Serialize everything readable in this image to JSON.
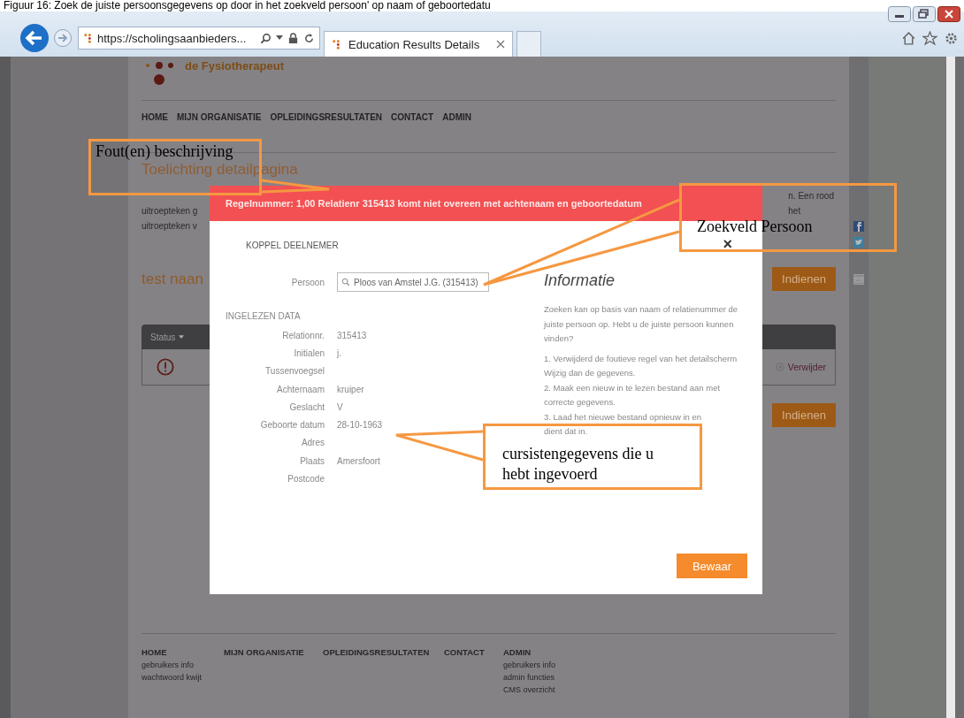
{
  "caption": "Figuur 16: Zoek de juiste persoonsgegevens op door in het zoekveld persoon' op naam of geboortedatu",
  "browser": {
    "url": "https://scholingsaanbieders...",
    "tabs": [
      {
        "title": "Education Results Details",
        "selected": true
      }
    ]
  },
  "site": {
    "logo": "de Fysiotherapeut",
    "nav": [
      "HOME",
      "MIJN ORGANISATIE",
      "OPLEIDINGSRESULTATEN",
      "CONTACT",
      "ADMIN"
    ],
    "heading": "Toelichting detailpagina",
    "intro_left": [
      "uitroepteken g",
      "uitroepteken v"
    ],
    "intro_right": [
      "n. Een rood",
      "het"
    ],
    "section_title": "test naan",
    "submit_buttons": [
      "Indienen",
      "Indienen"
    ],
    "table": {
      "columns": [
        "Status"
      ],
      "rows": [
        {
          "kind": "error",
          "action": "Verwijder"
        }
      ]
    },
    "footer": [
      {
        "title": "HOME",
        "links": [
          "gebruikers info",
          "wachtwoord kwijt"
        ]
      },
      {
        "title": "MIJN ORGANISATIE"
      },
      {
        "title": "OPLEIDINGSRESULTATEN"
      },
      {
        "title": "CONTACT"
      },
      {
        "title": "ADMIN",
        "links": [
          "gebruikers info",
          "admin functies",
          "CMS overzicht"
        ]
      }
    ]
  },
  "modal": {
    "error": "Regelnummer: 1,00 Relatienr 315413 komt niet overeen met achtenaam en geboortedatum",
    "title": "KOPPEL DEELNEMER",
    "close": "×",
    "person_label": "Persoon",
    "person_value": "Ploos van Amstel J.G. (315413)",
    "data_title": "INGELEZEN DATA",
    "fields": [
      {
        "label": "Relationnr.",
        "value": "315413"
      },
      {
        "label": "Initialen",
        "value": "j."
      },
      {
        "label": "Tussenvoegsel"
      },
      {
        "label": "Achternaam",
        "value": "kruiper"
      },
      {
        "label": "Geslacht",
        "value": "V"
      },
      {
        "label": "Geboorte datum",
        "value": "28-10-1963"
      },
      {
        "label": "Adres"
      },
      {
        "label": "Plaats",
        "value": "Amersfoort"
      },
      {
        "label": "Postcode"
      }
    ],
    "info_title": "Informatie",
    "info_intro": "Zoeken kan op basis van naam of relatienummer de juiste persoon op. Hebt u de juiste persoon kunnen vinden?",
    "info_steps": [
      "1. Verwijderd de foutieve regel van het detailscherm Wijzig dan de gegevens.",
      "2. Maak een nieuw in te lezen bestand aan met correcte gegevens.",
      "3. Laad het nieuwe bestand opnieuw in en",
      "dient dat in."
    ],
    "save": "Bewaar"
  },
  "callouts": [
    {
      "text": "Fout(en) beschrijving"
    },
    {
      "text": "Zoekveld Persoon"
    },
    {
      "text": "cursistengegevens die u hebt ingevoerd"
    }
  ]
}
